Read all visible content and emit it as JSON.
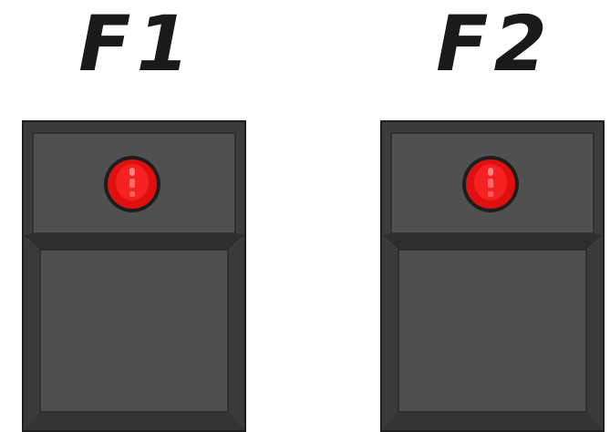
{
  "switches": [
    {
      "label": "F1",
      "led": {
        "color": "#e01010",
        "state": "on"
      }
    },
    {
      "label": "F2",
      "led": {
        "color": "#e01010",
        "state": "on"
      }
    }
  ],
  "colors": {
    "label_text": "#1a1a1a",
    "pedal_body": "#474747",
    "pedal_face": "#4f4f4f",
    "pedal_shadow": "#2e2e2e",
    "pedal_outline": "#1e1e1e",
    "led_red": "#e01010"
  }
}
